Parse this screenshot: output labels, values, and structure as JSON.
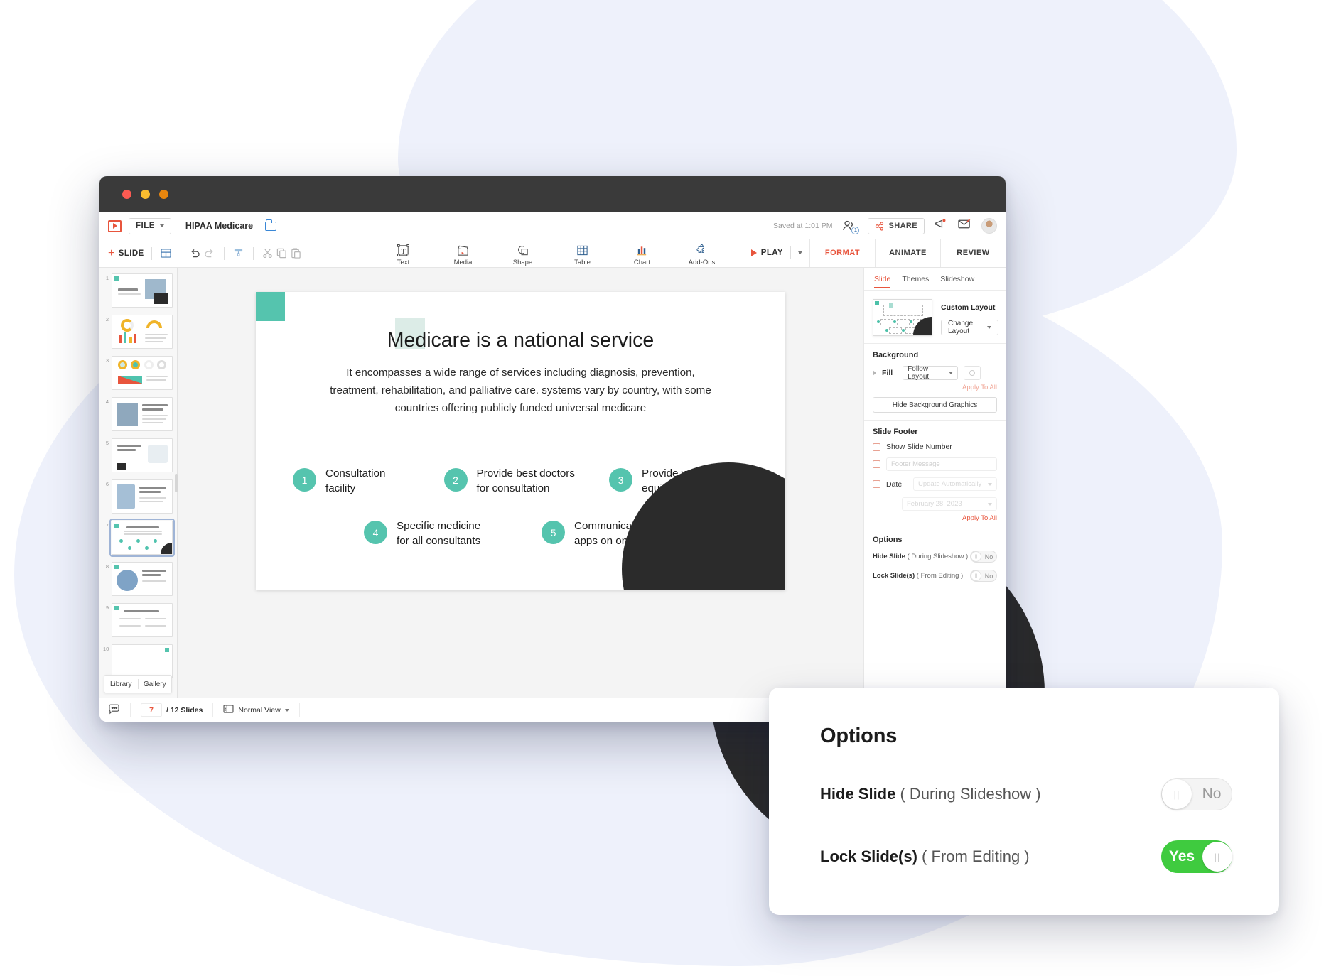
{
  "app": {
    "logo_icon": "presentation-logo-icon",
    "file_menu": "FILE",
    "document_title": "HIPAA Medicare",
    "folder_icon": "folder-icon",
    "saved_status": "Saved at 1:01 PM",
    "collaborators_count": "1",
    "share_label": "SHARE"
  },
  "toolbar": {
    "slide_label": "SLIDE",
    "center_tools": [
      {
        "label": "Text",
        "icon": "text-box-icon"
      },
      {
        "label": "Media",
        "icon": "media-clapper-icon"
      },
      {
        "label": "Shape",
        "icon": "shape-icon"
      },
      {
        "label": "Table",
        "icon": "table-grid-icon"
      },
      {
        "label": "Chart",
        "icon": "bar-chart-icon"
      },
      {
        "label": "Add-Ons",
        "icon": "puzzle-piece-icon"
      }
    ],
    "play_label": "PLAY",
    "tabs": [
      {
        "label": "FORMAT",
        "active": true
      },
      {
        "label": "ANIMATE",
        "active": false
      },
      {
        "label": "REVIEW",
        "active": false
      }
    ]
  },
  "thumbnails": {
    "numbers": [
      "1",
      "2",
      "3",
      "4",
      "5",
      "6",
      "7",
      "8",
      "9",
      "10"
    ],
    "selected": "7",
    "library_label": "Library",
    "gallery_label": "Gallery"
  },
  "slide": {
    "title": "Medicare is a national service",
    "body": "It encompasses a wide range of services including diagnosis, prevention, treatment, rehabilitation, and palliative care. systems vary by country, with some countries offering publicly funded universal medicare",
    "accent_color": "#55c4ae",
    "features": [
      {
        "num": "1",
        "text_line1": "Consultation",
        "text_line2": "facility"
      },
      {
        "num": "2",
        "text_line1": "Provide best doctors",
        "text_line2": "for consultation"
      },
      {
        "num": "3",
        "text_line1": "Provide world class",
        "text_line2": "equipment"
      },
      {
        "num": "4",
        "text_line1": "Specific medicine",
        "text_line2": "for all consultants"
      },
      {
        "num": "5",
        "text_line1": "Communication",
        "text_line2": "apps on online"
      }
    ]
  },
  "format_panel": {
    "tabs": [
      {
        "label": "Slide",
        "active": true
      },
      {
        "label": "Themes",
        "active": false
      },
      {
        "label": "Slideshow",
        "active": false
      }
    ],
    "layout_title": "Custom Layout",
    "change_layout": "Change Layout",
    "background": {
      "heading": "Background",
      "fill_label": "Fill",
      "fill_value": "Follow Layout",
      "apply_to_all": "Apply To All",
      "hide_bg_graphics": "Hide Background Graphics"
    },
    "slide_footer": {
      "heading": "Slide Footer",
      "show_slide_number": "Show Slide Number",
      "footer_message_placeholder": "Footer Message",
      "date_label": "Date",
      "date_mode": "Update Automatically",
      "date_value": "February 28, 2023",
      "apply_to_all": "Apply To All"
    },
    "options": {
      "heading": "Options",
      "hide_slide_label": "Hide Slide",
      "hide_slide_hint": "( During Slideshow )",
      "hide_slide_value": "No",
      "lock_slide_label": "Lock Slide(s)",
      "lock_slide_hint": "( From Editing )",
      "lock_slide_value": "No"
    }
  },
  "statusbar": {
    "comment_icon": "comment-icon",
    "page_number": "7",
    "slides_total": "/ 12 Slides",
    "view_icon": "normal-view-icon",
    "view_mode": "Normal View"
  },
  "overlay_card": {
    "heading": "Options",
    "hide_slide_label": "Hide Slide",
    "hide_slide_hint": "( During Slideshow )",
    "hide_slide_value": "No",
    "hide_slide_state": "off",
    "lock_slide_label": "Lock Slide(s)",
    "lock_slide_hint": "( From Editing )",
    "lock_slide_value": "Yes",
    "lock_slide_state": "on",
    "on_color": "#3fcb3f"
  }
}
